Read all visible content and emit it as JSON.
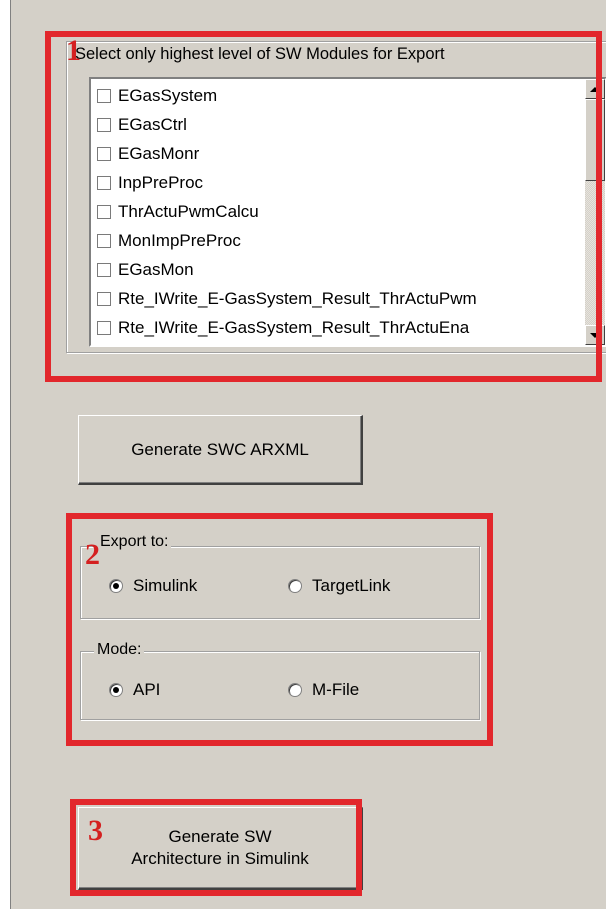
{
  "modules_group": {
    "legend": "Select only highest level of SW Modules for Export",
    "items": [
      "EGasSystem",
      "EGasCtrl",
      "EGasMonr",
      "InpPreProc",
      "ThrActuPwmCalcu",
      "MonImpPreProc",
      "EGasMon",
      "Rte_IWrite_E-GasSystem_Result_ThrActuPwm",
      "Rte_IWrite_E-GasSystem_Result_ThrActuEna"
    ]
  },
  "generate_swc_button": "Generate SWC ARXML",
  "export_group": {
    "legend": "Export to:",
    "options": [
      "Simulink",
      "TargetLink"
    ],
    "selected": "Simulink"
  },
  "mode_group": {
    "legend": "Mode:",
    "options": [
      "API",
      "M-File"
    ],
    "selected": "API"
  },
  "generate_arch_button": {
    "line1": "Generate SW",
    "line2": "Architecture in Simulink"
  },
  "annotations": {
    "one": "1",
    "two": "2",
    "three": "3",
    "color": "#e2272c"
  }
}
